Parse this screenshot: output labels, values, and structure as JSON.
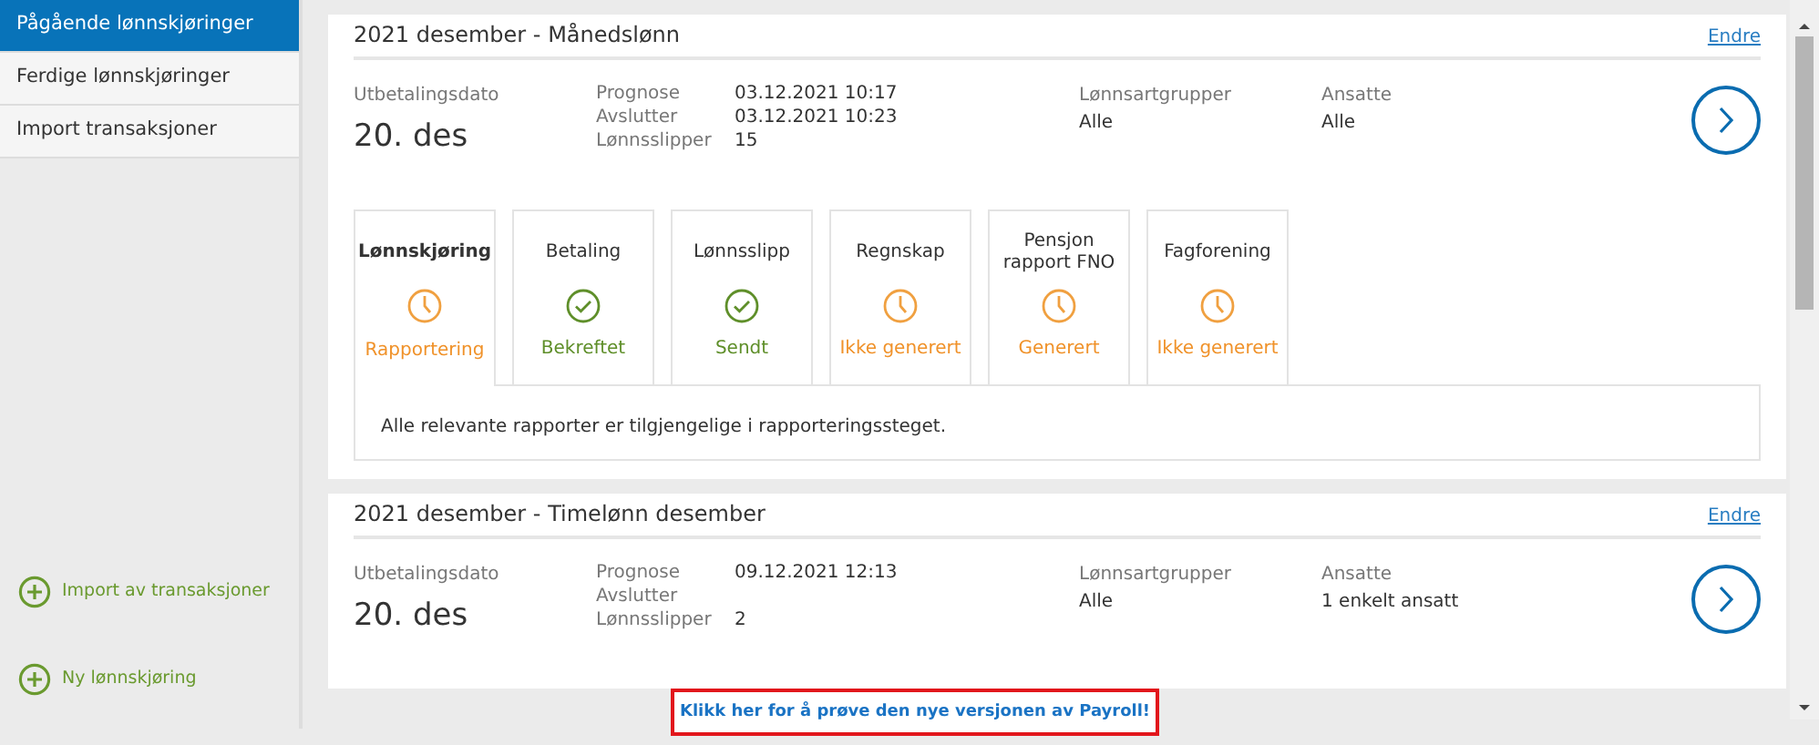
{
  "sidebar": {
    "items": [
      {
        "label": "Pågående lønnskjøringer",
        "selected": true
      },
      {
        "label": "Ferdige lønnskjøringer",
        "selected": false
      },
      {
        "label": "Import transaksjoner",
        "selected": false
      }
    ],
    "actions": [
      "Import av transaksjoner",
      "Ny lønnskjøring"
    ]
  },
  "runs": [
    {
      "title": "2021 desember - Månedslønn",
      "edit": "Endre",
      "date_label": "Utbetalingsdato",
      "date_num": "20.",
      "date_month": "des",
      "details": [
        {
          "label": "Prognose",
          "value": "03.12.2021 10:17"
        },
        {
          "label": "Avslutter",
          "value": "03.12.2021 10:23"
        },
        {
          "label": "Lønnsslipper",
          "value": "15"
        }
      ],
      "groups_label": "Lønnsartgrupper",
      "groups_value": "Alle",
      "employees_label": "Ansatte",
      "employees_value": "Alle",
      "steps": [
        {
          "title": "Lønnskjøring",
          "kind": "clock",
          "status": "Rapportering",
          "selected": true
        },
        {
          "title": "Betaling",
          "kind": "check",
          "status": "Bekreftet",
          "selected": false
        },
        {
          "title": "Lønnsslipp",
          "kind": "check",
          "status": "Sendt",
          "selected": false
        },
        {
          "title": "Regnskap",
          "kind": "clock",
          "status": "Ikke generert",
          "selected": false
        },
        {
          "title": "Pensjon rapport FNO",
          "kind": "clock",
          "status": "Generert",
          "selected": false
        },
        {
          "title": "Fagforening",
          "kind": "clock",
          "status": "Ikke generert",
          "selected": false
        }
      ],
      "step_message": "Alle relevante rapporter er tilgjengelige i rapporteringssteget."
    },
    {
      "title": "2021 desember - Timelønn desember",
      "edit": "Endre",
      "date_label": "Utbetalingsdato",
      "date_num": "20.",
      "date_month": "des",
      "details": [
        {
          "label": "Prognose",
          "value": "09.12.2021 12:13"
        },
        {
          "label": "Avslutter"
        },
        {
          "label": "Lønnsslipper",
          "value": "2"
        }
      ],
      "groups_label": "Lønnsartgrupper",
      "groups_value": "Alle",
      "employees_label": "Ansatte",
      "employees_value": "1 enkelt ansatt"
    }
  ],
  "banner": "Klikk her for å prøve den nye versjonen av Payroll!"
}
